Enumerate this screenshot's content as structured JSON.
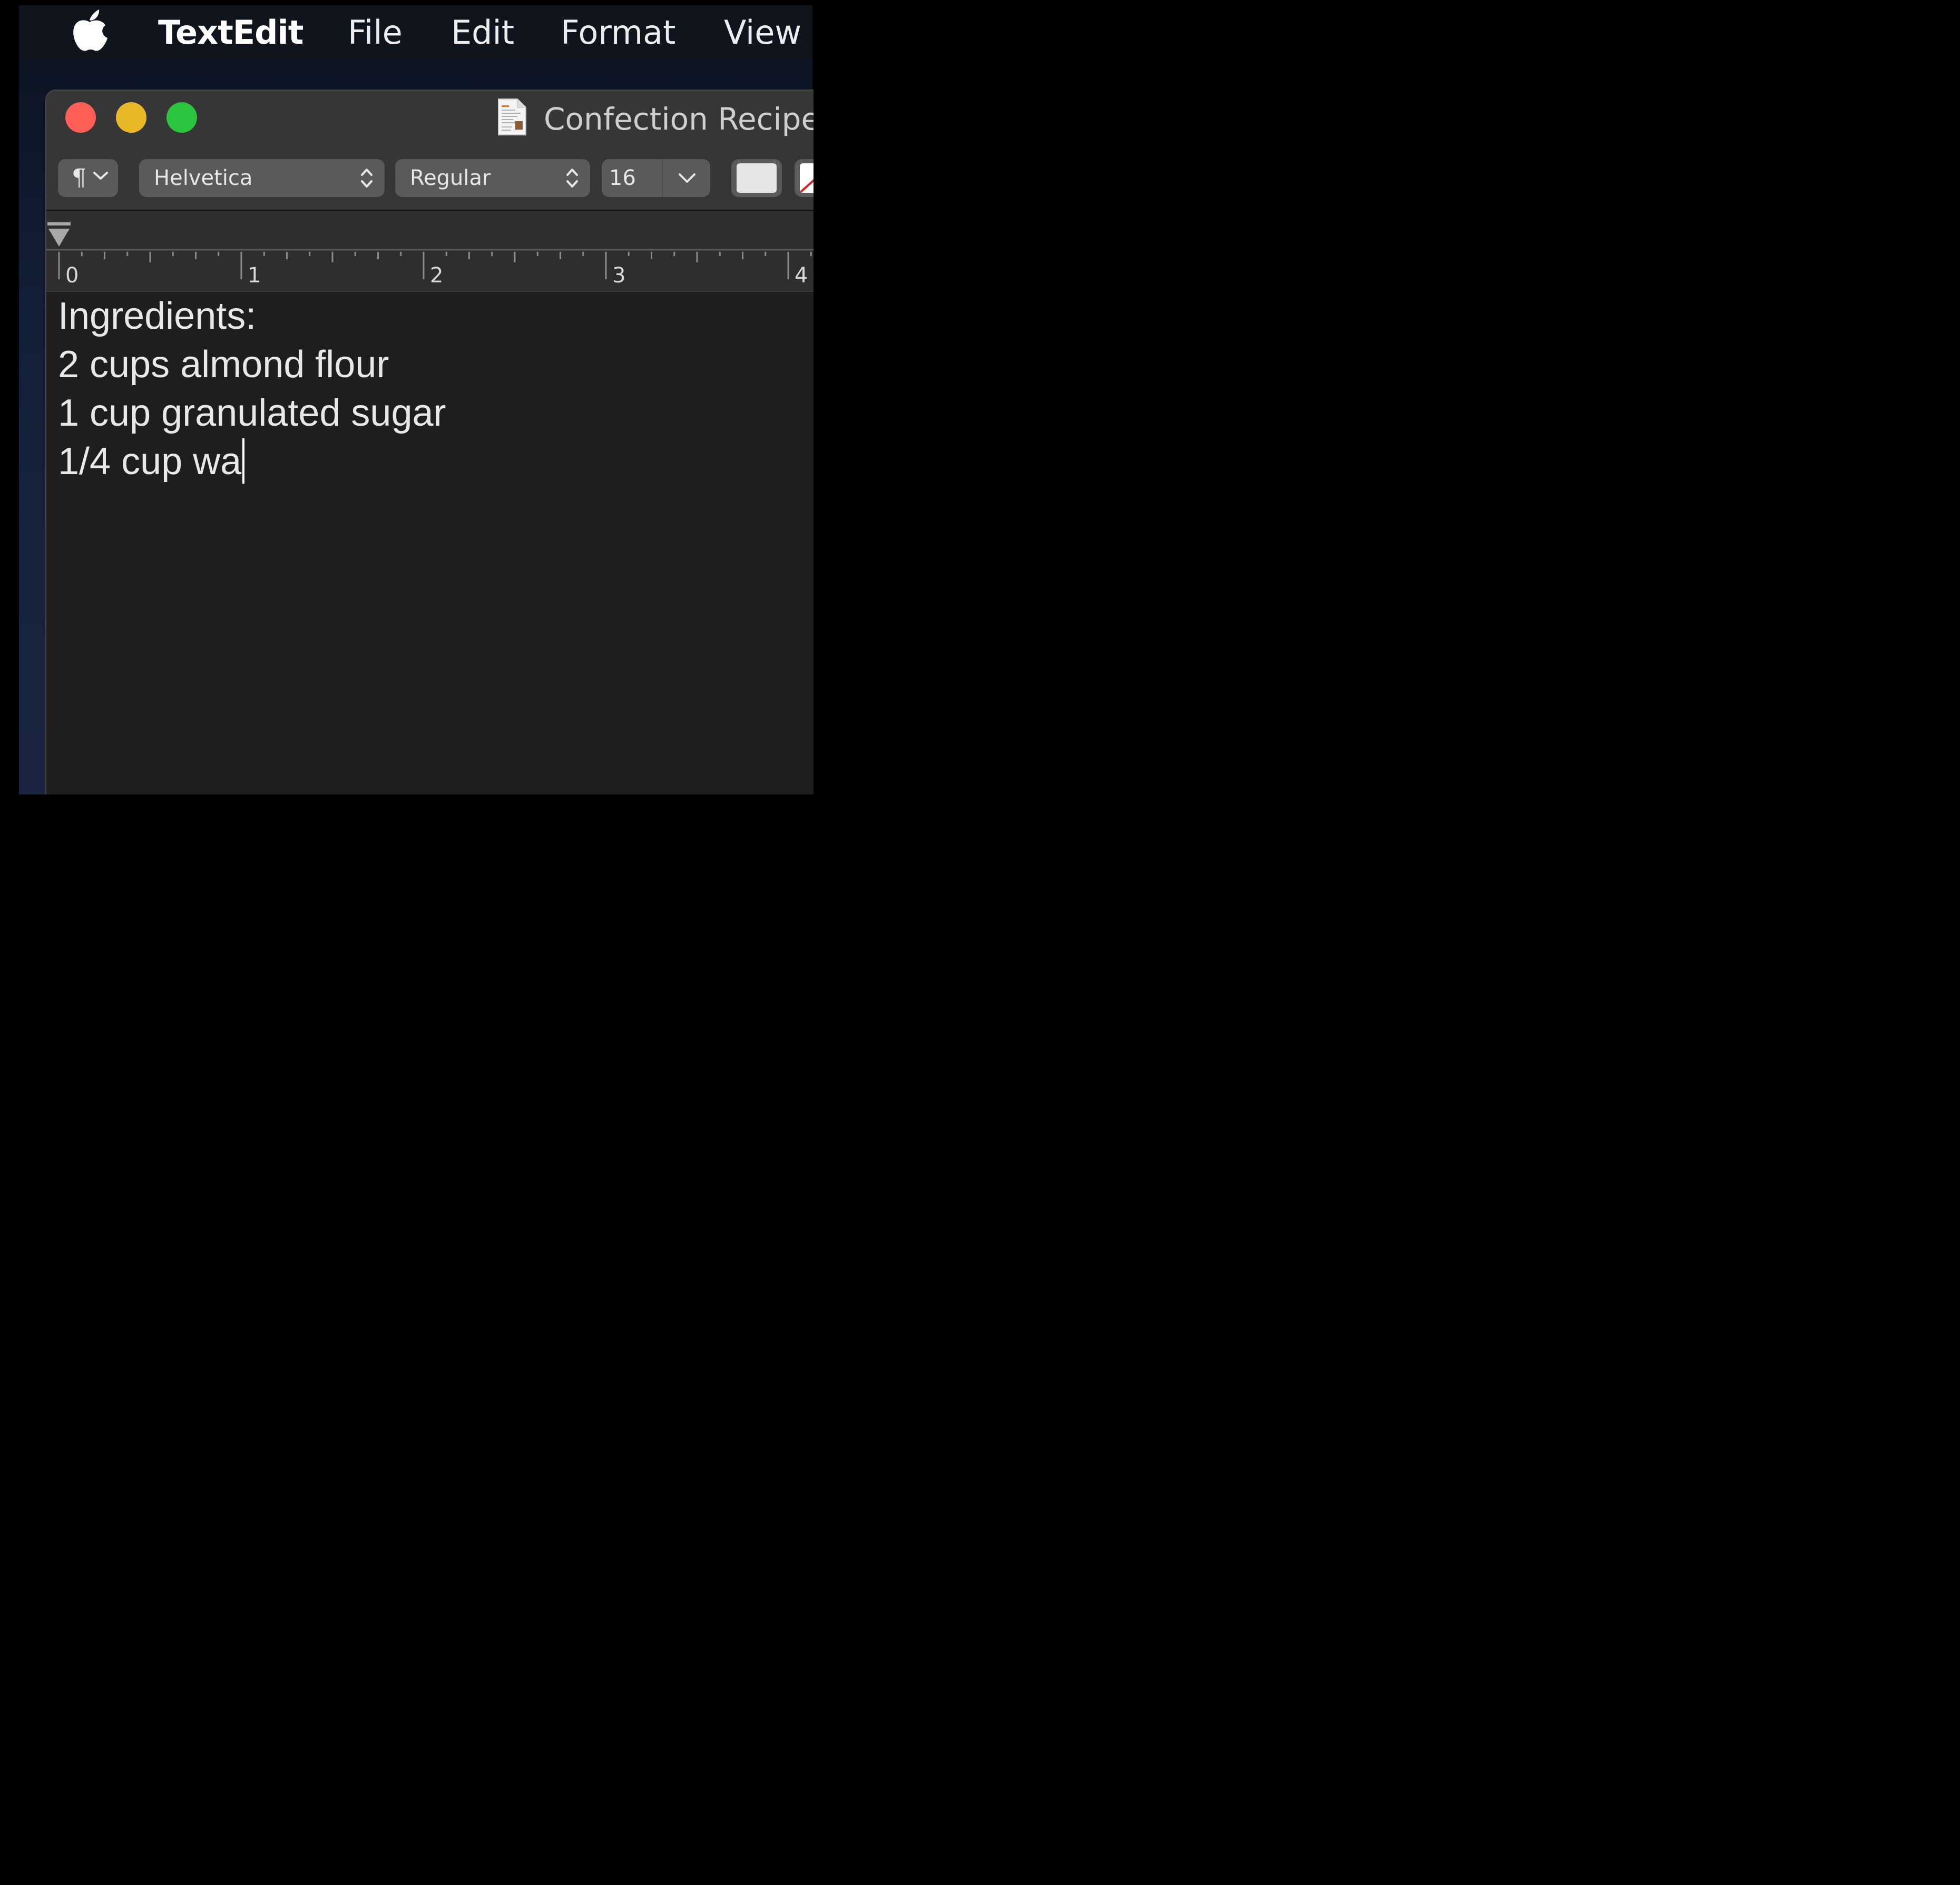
{
  "menubar": {
    "apple_icon": "apple-logo-icon",
    "app_name": "TextEdit",
    "items": [
      "File",
      "Edit",
      "Format",
      "View"
    ]
  },
  "window": {
    "title": "Confection Recipe",
    "document_icon": "rich-text-document-icon",
    "traffic_lights": {
      "close": "#ff5f57",
      "minimize": "#e8b828",
      "zoom": "#2ac43e"
    }
  },
  "toolbar": {
    "paragraph_glyph": "¶",
    "font_family": "Helvetica",
    "font_style": "Regular",
    "font_size": "16",
    "text_color": "#e6e6e6"
  },
  "ruler": {
    "labels": [
      "0",
      "1",
      "2",
      "3",
      "4"
    ]
  },
  "document": {
    "lines": [
      "Ingredients:",
      "2 cups almond flour",
      "1 cup granulated sugar",
      "1/4 cup wa"
    ]
  }
}
